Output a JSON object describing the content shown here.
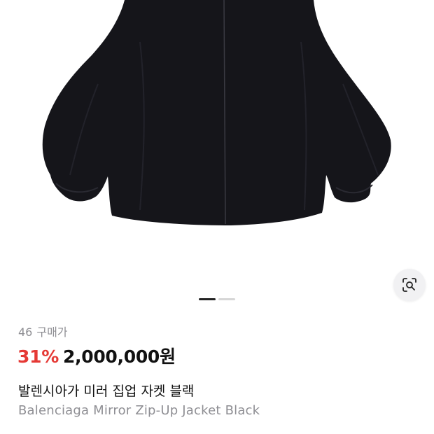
{
  "product": {
    "image_icon": "jacket-photo",
    "carousel": {
      "total": 2,
      "active": 1
    },
    "lens_icon": "visual-search-icon",
    "purchase_count": "46",
    "purchase_label": "구매가",
    "discount": "31%",
    "price": "2,000,000원",
    "title_ko": "발렌시아가 미러 집업 자켓 블랙",
    "title_en": "Balenciaga Mirror Zip-Up Jacket Black"
  },
  "colors": {
    "discount": "#e53935",
    "muted_text": "#8e8e93",
    "jacket": "#15151a"
  }
}
